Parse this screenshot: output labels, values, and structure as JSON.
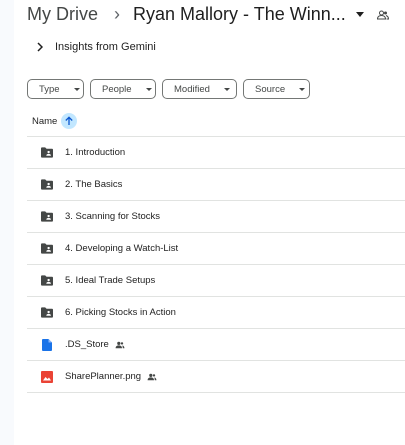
{
  "breadcrumb": {
    "root": "My Drive",
    "separator": "›",
    "current": "Ryan Mallory - The Winn...",
    "shared_icon": "people-icon"
  },
  "gemini": {
    "label": "Insights from Gemini",
    "icon": "chevron-right-icon"
  },
  "filters": [
    {
      "label": "Type"
    },
    {
      "label": "People"
    },
    {
      "label": "Modified"
    },
    {
      "label": "Source"
    }
  ],
  "list_header": {
    "name_label": "Name",
    "sort_icon": "arrow-up-icon",
    "sort_highlight": "#c2e7ff"
  },
  "files": [
    {
      "name": "1. Introduction",
      "kind": "shared-folder",
      "shared": false
    },
    {
      "name": "2. The Basics",
      "kind": "shared-folder",
      "shared": false
    },
    {
      "name": "3. Scanning for Stocks",
      "kind": "shared-folder",
      "shared": false
    },
    {
      "name": "4. Developing a Watch-List",
      "kind": "shared-folder",
      "shared": false
    },
    {
      "name": "5. Ideal Trade Setups",
      "kind": "shared-folder",
      "shared": false
    },
    {
      "name": "6. Picking Stocks in Action",
      "kind": "shared-folder",
      "shared": false
    },
    {
      "name": ".DS_Store",
      "kind": "document",
      "shared": true
    },
    {
      "name": "SharePlanner.png",
      "kind": "image",
      "shared": true
    }
  ],
  "colors": {
    "folder": "#444746",
    "document": "#1a73e8",
    "image": "#ea4335"
  }
}
